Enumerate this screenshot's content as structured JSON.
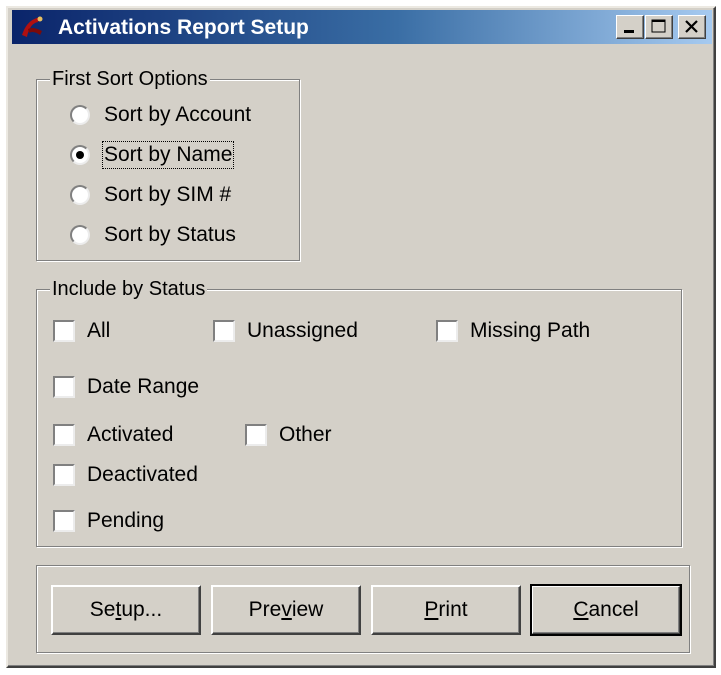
{
  "window": {
    "title": "Activations Report Setup",
    "controls": [
      "minimize-icon",
      "maximize-icon",
      "close-icon"
    ]
  },
  "first_sort": {
    "legend": "First Sort Options",
    "options": [
      {
        "label": "Sort by Account",
        "selected": false
      },
      {
        "label": "Sort by Name",
        "selected": true
      },
      {
        "label": "Sort by SIM #",
        "selected": false
      },
      {
        "label": "Sort by Status",
        "selected": false
      }
    ]
  },
  "include_status": {
    "legend": "Include by Status",
    "all": "All",
    "unassigned": "Unassigned",
    "missing_path": "Missing Path",
    "date_range": "Date Range",
    "activated": "Activated",
    "other": "Other",
    "deactivated": "Deactivated",
    "pending": "Pending"
  },
  "buttons": {
    "setup_pre": "Se",
    "setup_ul": "t",
    "setup_post": "up...",
    "preview_pre": "Pre",
    "preview_ul": "v",
    "preview_post": "iew",
    "print_pre": "",
    "print_ul": "P",
    "print_post": "rint",
    "cancel_pre": "",
    "cancel_ul": "C",
    "cancel_post": "ancel"
  }
}
